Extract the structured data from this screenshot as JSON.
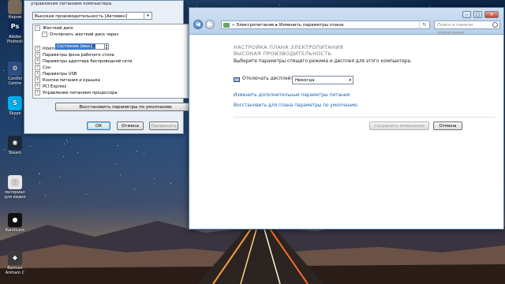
{
  "desktop": {
    "icons": [
      {
        "label": "Керни",
        "color": "#7a6a5a",
        "glyph": ""
      },
      {
        "label": "Adobe Photosh",
        "color": "#0b2a57",
        "glyph": "Ps"
      },
      {
        "label": "Control Centre",
        "color": "#2d4f86",
        "glyph": "⚙"
      },
      {
        "label": "Skype",
        "color": "#00aff0",
        "glyph": "S"
      },
      {
        "label": "Steam",
        "color": "#1b2838",
        "glyph": "◉"
      },
      {
        "label": "материал для видео",
        "color": "#e6e6e6",
        "glyph": "▤"
      },
      {
        "label": "Bandicam",
        "color": "#111111",
        "glyph": "●"
      },
      {
        "label": "Batman Arkham C",
        "color": "#3b3b3b",
        "glyph": "◆"
      }
    ]
  },
  "power_dialog": {
    "header_text": "управления питанием компьютера.",
    "plan_selected": "Высокая производительность [Активен]",
    "tree": {
      "rows": [
        {
          "label": "Жесткий диск",
          "expander": "−",
          "indent": 1
        },
        {
          "label": "Отключать жесткий диск через",
          "expander": "−",
          "indent": 2
        },
        {
          "label": "Internet Explorer",
          "expander": "+",
          "indent": 1
        },
        {
          "label": "Параметры фона рабочего стола",
          "expander": "+",
          "indent": 1
        },
        {
          "label": "Параметры адаптера беспроводной сети",
          "expander": "+",
          "indent": 1
        },
        {
          "label": "Сон",
          "expander": "+",
          "indent": 1
        },
        {
          "label": "Параметры USB",
          "expander": "+",
          "indent": 1
        },
        {
          "label": "Кнопки питания и крышка",
          "expander": "+",
          "indent": 1
        },
        {
          "label": "PCI Express",
          "expander": "+",
          "indent": 1
        },
        {
          "label": "Управление питанием процессора",
          "expander": "+",
          "indent": 1
        }
      ],
      "state_label": "Состояние (мин.):",
      "state_value": "0"
    },
    "restore_button": "Восстановить параметры по умолчанию",
    "ok_button": "ОК",
    "cancel_button": "Отмена",
    "apply_button": "Применить"
  },
  "main_window": {
    "controls": {
      "minimize": "–",
      "maximize": "□",
      "close": "✕"
    },
    "breadcrumb": "« Электропитание ▸ Изменить параметры плана",
    "search_placeholder": "Поиск в панели управления",
    "title": "Настройка плана электропитания: Высокая производительность",
    "subtitle": "Выберите параметры спящего режима и дисплея для этого компьютера.",
    "display_label": "Отключать дисплей:",
    "display_value": "Никогда",
    "link_advanced": "Изменить дополнительные параметры питания",
    "link_restore": "Восстановить для плана параметры по умолчанию",
    "save_button": "Сохранить изменения",
    "cancel_button": "Отмена"
  }
}
